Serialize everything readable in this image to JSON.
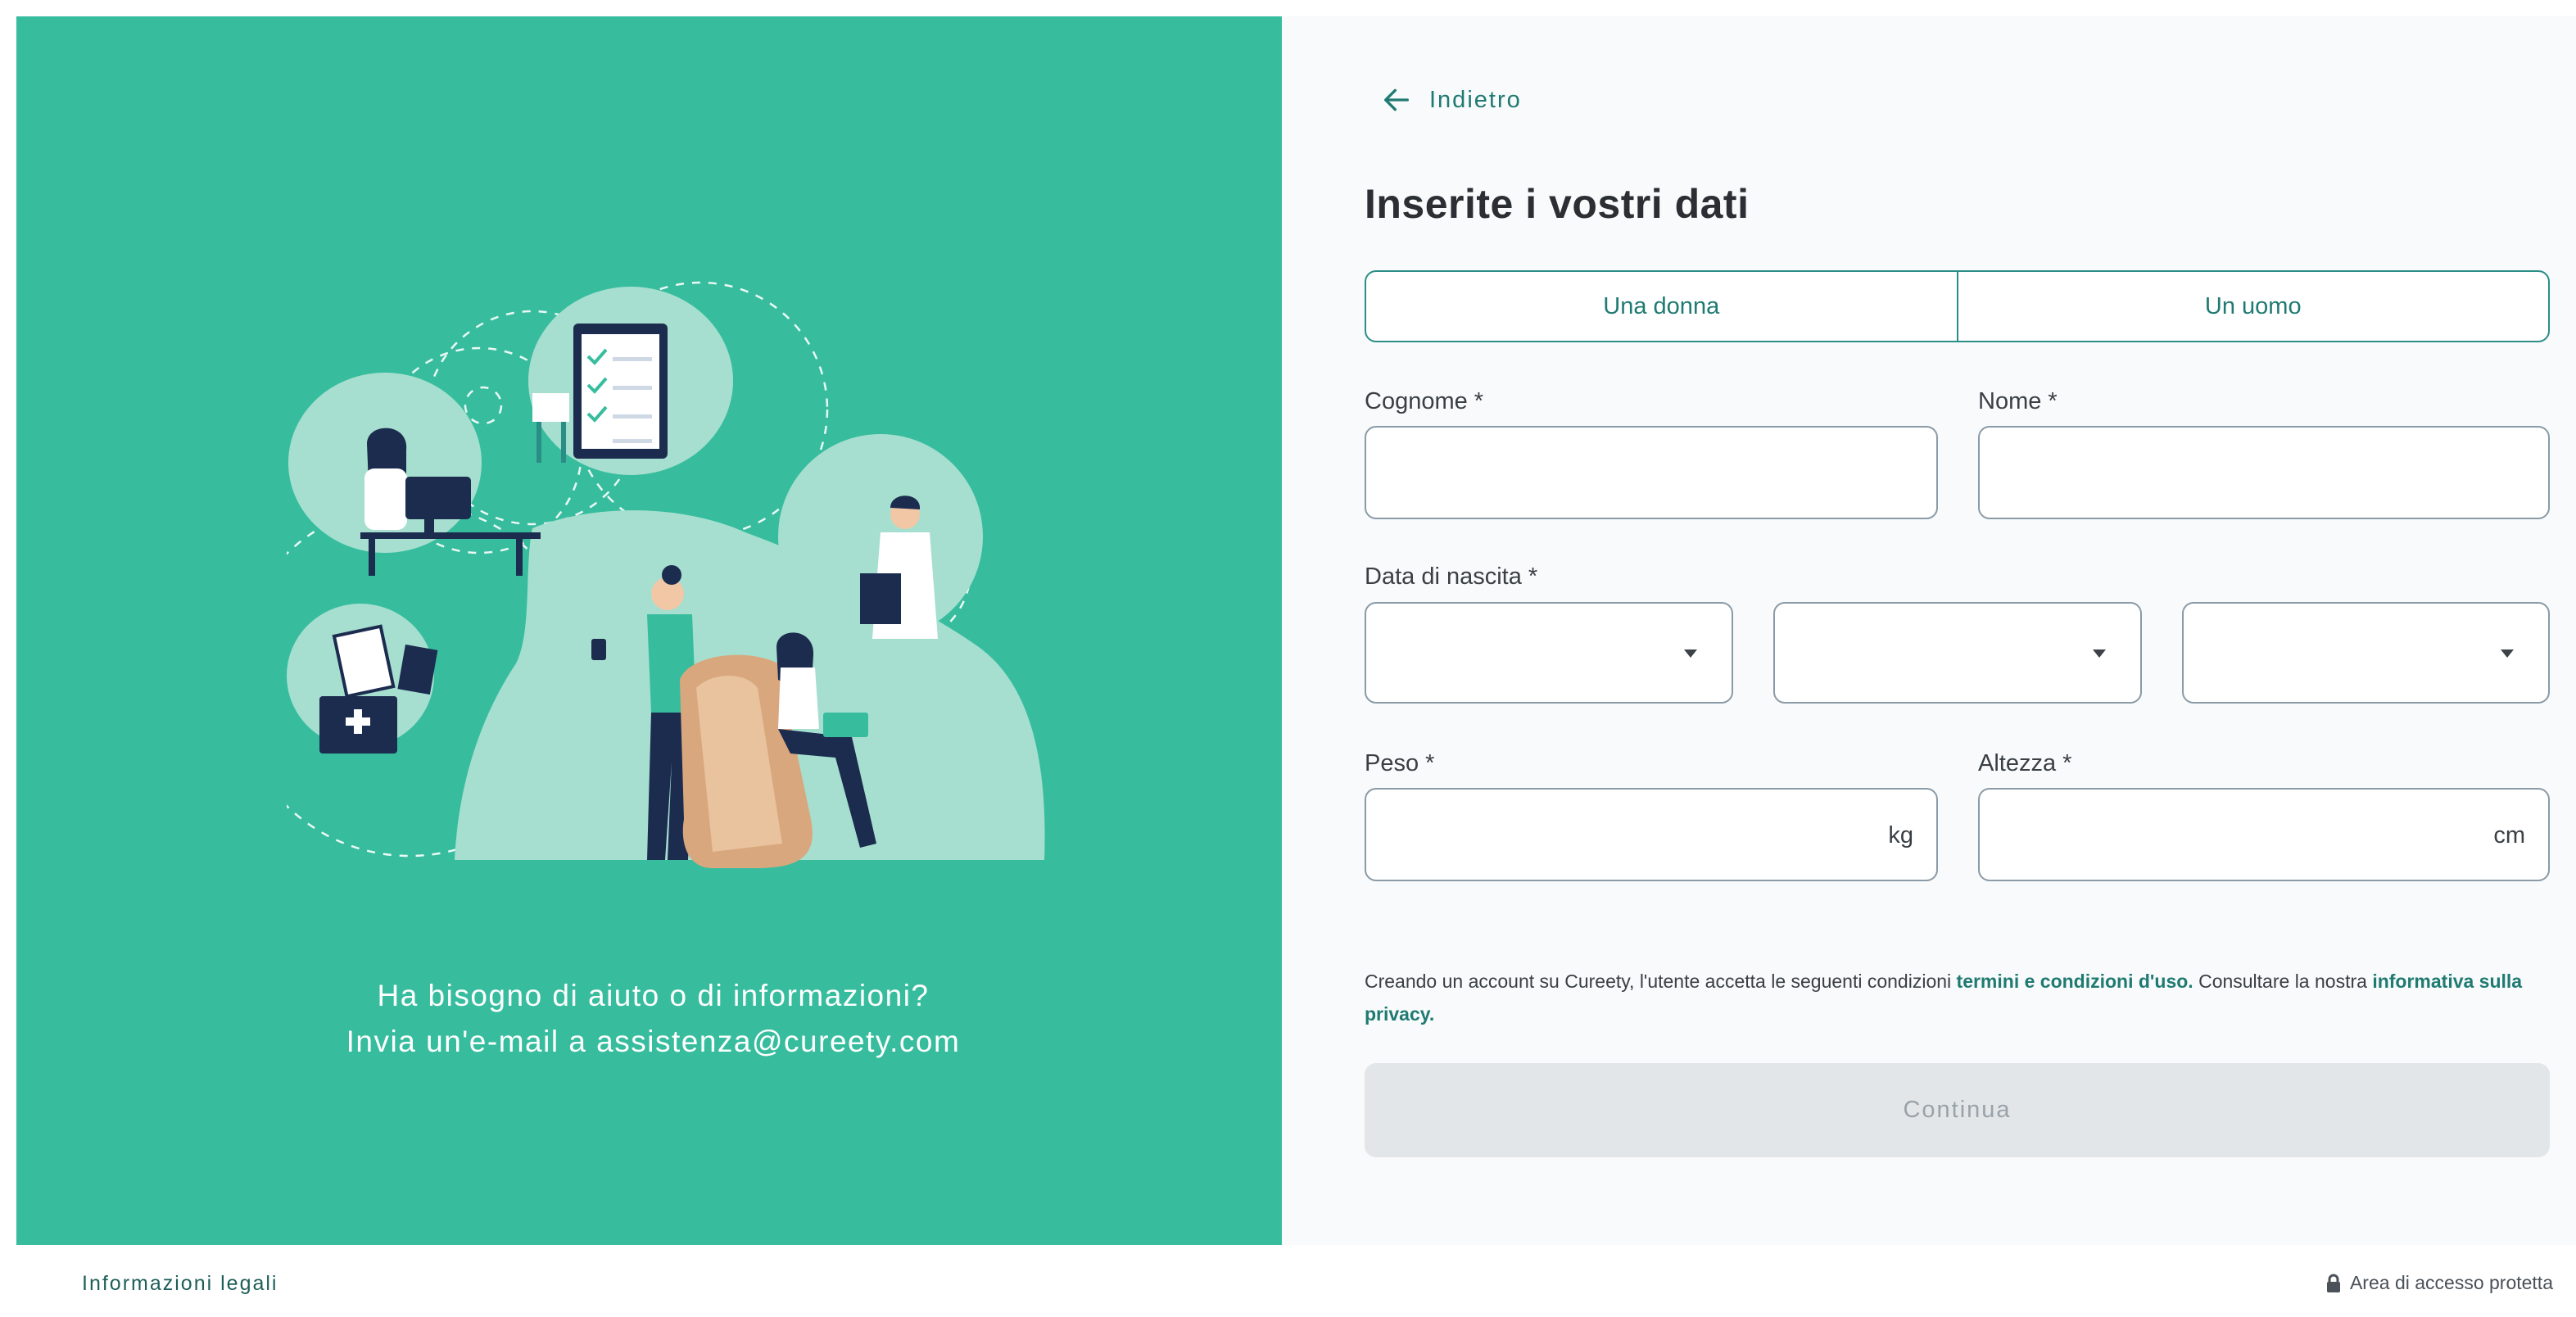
{
  "colors": {
    "brand_green": "#37bd9e",
    "accent_teal": "#1f7a72",
    "panel_background": "#f8fafb",
    "disabled_button": "#e3e6e8"
  },
  "back_link": {
    "icon": "arrow-left-icon",
    "label": "Indietro"
  },
  "form": {
    "title": "Inserite i vostri dati",
    "gender_options": [
      "Una donna",
      "Un uomo"
    ],
    "fields": {
      "surname_label": "Cognome *",
      "name_label": "Nome *",
      "birthdate_label": "Data di nascita *",
      "weight_label": "Peso *",
      "weight_unit": "kg",
      "height_label": "Altezza *",
      "height_unit": "cm"
    },
    "terms": {
      "prefix": "Creando un account su Cureety, l'utente accetta le seguenti condizioni ",
      "terms_link": "termini e condizioni d'uso.",
      "middle": " Consultare la nostra ",
      "privacy_link": "informativa sulla privacy."
    },
    "continue_label": "Continua"
  },
  "help": {
    "line1": "Ha bisogno di aiuto o di informazioni?",
    "line2": "Invia un'e-mail a assistenza@cureety.com"
  },
  "footer": {
    "legal_label": "Informazioni legali",
    "secure_icon": "lock-icon",
    "secure_label": "Area di accesso protetta"
  }
}
